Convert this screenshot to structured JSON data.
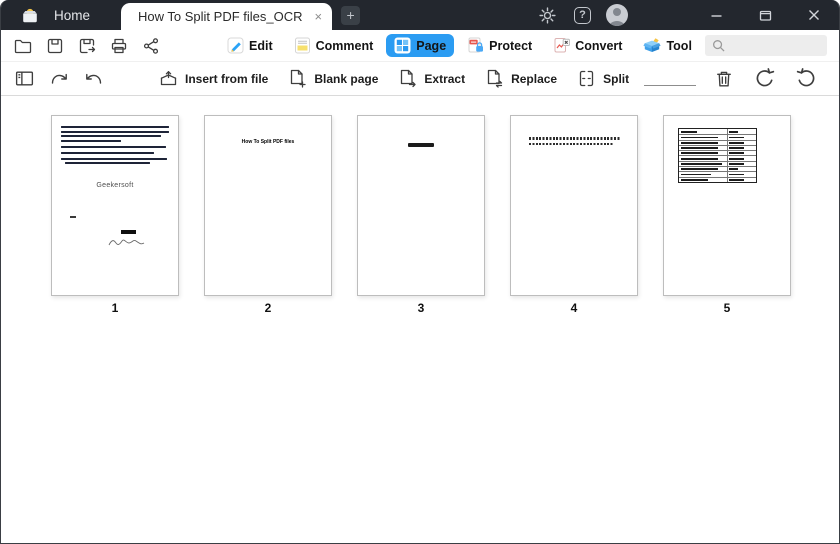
{
  "titlebar": {
    "home_label": "Home",
    "tab": {
      "title": "How To Split PDF files_OCR",
      "close_glyph": "×"
    },
    "new_tab_glyph": "+",
    "help_glyph": "?"
  },
  "toolbar": {
    "tabs": [
      {
        "label": "Edit"
      },
      {
        "label": "Comment"
      },
      {
        "label": "Page",
        "active": true
      },
      {
        "label": "Protect"
      },
      {
        "label": "Convert"
      },
      {
        "label": "Tool"
      }
    ],
    "search": {
      "value": "",
      "placeholder": ""
    }
  },
  "page_toolbar": {
    "insert_from_file_label": "Insert from file",
    "blank_page_label": "Blank page",
    "extract_label": "Extract",
    "replace_label": "Replace",
    "split_label": "Split",
    "page_range_value": ""
  },
  "pages": [
    {
      "number": "1",
      "body_text": "Geekersoft"
    },
    {
      "number": "2",
      "title_text": "How To Split PDF files"
    },
    {
      "number": "3"
    },
    {
      "number": "4"
    },
    {
      "number": "5"
    }
  ],
  "colors": {
    "accent_blue": "#2b9cf2",
    "titlebar_bg": "#23272e"
  }
}
